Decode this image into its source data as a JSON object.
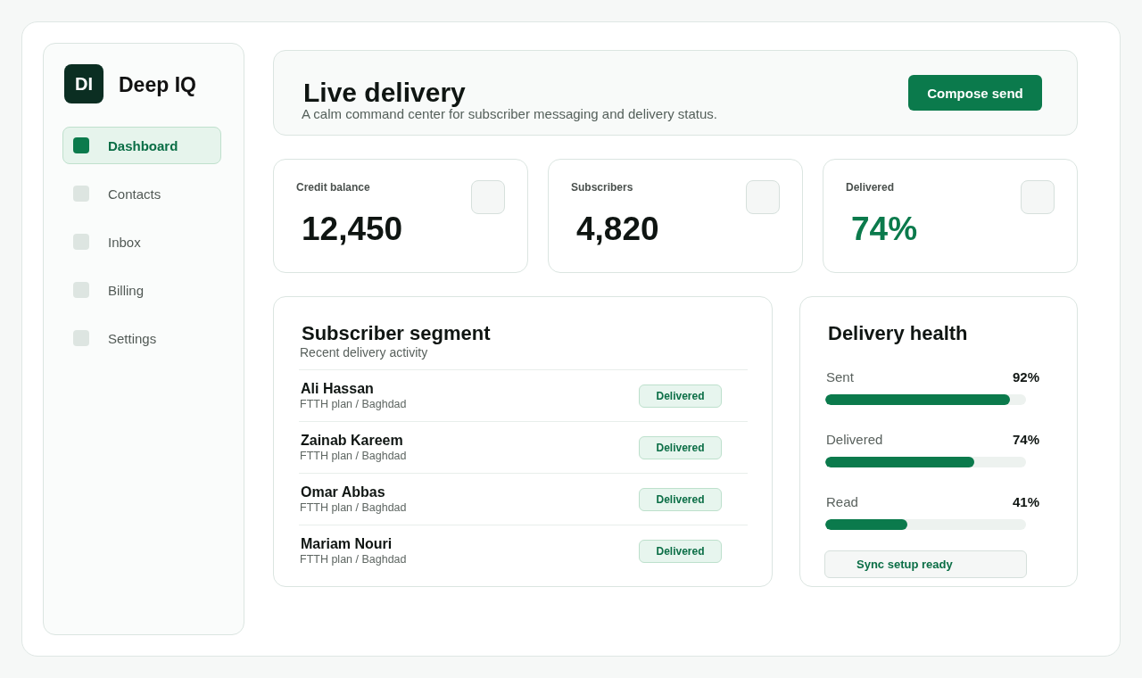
{
  "brand": {
    "logo": "DI",
    "name": "Deep IQ"
  },
  "nav": [
    {
      "label": "Dashboard",
      "selected": true
    },
    {
      "label": "Contacts",
      "selected": false
    },
    {
      "label": "Inbox",
      "selected": false
    },
    {
      "label": "Billing",
      "selected": false
    },
    {
      "label": "Settings",
      "selected": false
    }
  ],
  "header": {
    "title": "Live delivery",
    "subtitle": "A calm command center for subscriber messaging and delivery status.",
    "action": "Compose send"
  },
  "stats": [
    {
      "label": "Credit balance",
      "value": "12,450",
      "highlight": false
    },
    {
      "label": "Subscribers",
      "value": "4,820",
      "highlight": false
    },
    {
      "label": "Delivered",
      "value": "74%",
      "highlight": true
    }
  ],
  "segment": {
    "title": "Subscriber segment",
    "subtitle": "Recent delivery activity",
    "rows": [
      {
        "name": "Ali Hassan",
        "detail": "FTTH plan / Baghdad",
        "status": "Delivered"
      },
      {
        "name": "Zainab Kareem",
        "detail": "FTTH plan / Baghdad",
        "status": "Delivered"
      },
      {
        "name": "Omar Abbas",
        "detail": "FTTH plan / Baghdad",
        "status": "Delivered"
      },
      {
        "name": "Mariam Nouri",
        "detail": "FTTH plan / Baghdad",
        "status": "Delivered"
      }
    ]
  },
  "health": {
    "title": "Delivery health",
    "metrics": [
      {
        "label": "Sent",
        "value": "92%",
        "level": 0.92
      },
      {
        "label": "Delivered",
        "value": "74%",
        "level": 0.74
      },
      {
        "label": "Read",
        "value": "41%",
        "level": 0.41
      }
    ],
    "status": "Sync setup ready"
  }
}
